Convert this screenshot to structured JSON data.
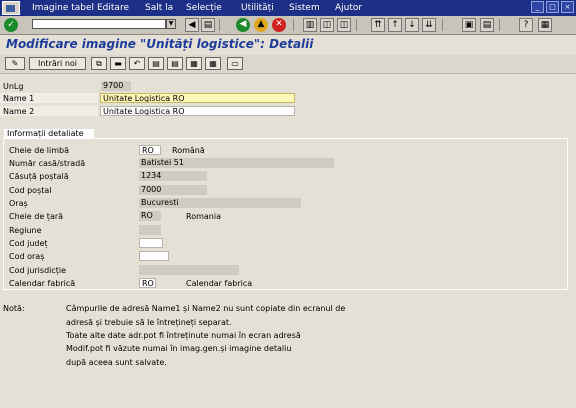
{
  "menu": [
    "Imagine tabel",
    "Editare",
    "Salt la",
    "Selecție",
    "Utilități",
    "Sistem",
    "Ajutor"
  ],
  "title": "Modificare imagine \"Unități logistice\": Detalii",
  "toolbar": {
    "new_entries_label": "Intrări noi"
  },
  "header_fields": [
    {
      "label": "UnLg",
      "value": "9700"
    },
    {
      "label": "Name 1",
      "value": "Unitate Logistica RO"
    },
    {
      "label": "Name 2",
      "value": "Unitate Logistica RO"
    }
  ],
  "group": {
    "title": "Informații detaliate",
    "rows": [
      {
        "label": "Cheie de limbă",
        "value": "RO",
        "desc": "Română"
      },
      {
        "label": "Număr casă/stradă",
        "value": "Batistei 51",
        "desc": ""
      },
      {
        "label": "Căsuță poștală",
        "value": "1234",
        "desc": ""
      },
      {
        "label": "Cod poștal",
        "value": "7000",
        "desc": ""
      },
      {
        "label": "Oraș",
        "value": "Bucuresti",
        "desc": ""
      },
      {
        "label": "Cheie de țară",
        "value": "RO",
        "desc": "Romania"
      },
      {
        "label": "Regiune",
        "value": "",
        "desc": ""
      },
      {
        "label": "Cod județ",
        "value": "",
        "desc": ""
      },
      {
        "label": "Cod oraș",
        "value": "",
        "desc": ""
      },
      {
        "label": "Cod jurisdicție",
        "value": "",
        "desc": ""
      },
      {
        "label": "Calendar fabrică",
        "value": "RO",
        "desc": "Calendar fabrica"
      }
    ]
  },
  "note": {
    "label": "Notă:",
    "lines": [
      "Câmpurile de adresă Name1 și Name2 nu sunt copiate din ecranul de",
      "adresă și trebuie să le întrețineți separat.",
      "Toate alte date adr.pot fi întreținute numai în ecran adresă",
      "Modif.pot fi văzute numai în imag.gen.și imagine detaliu",
      "după aceea sunt salvate."
    ]
  }
}
